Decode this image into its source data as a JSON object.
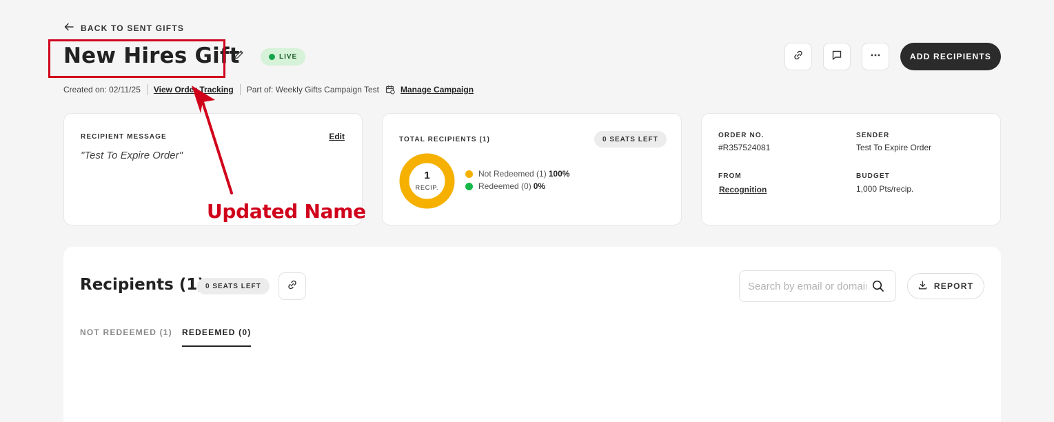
{
  "nav": {
    "back_label": "BACK TO SENT GIFTS"
  },
  "header": {
    "title": "New Hires Gift",
    "status": "LIVE",
    "add_recipients_label": "ADD RECIPIENTS"
  },
  "meta": {
    "created": "Created on: 02/11/25",
    "view_order_tracking": "View Order Tracking",
    "part_of": "Part of: Weekly Gifts Campaign Test",
    "manage_campaign": "Manage Campaign"
  },
  "annotation": {
    "text": "Updated Name",
    "color": "#d0021b"
  },
  "message_card": {
    "label": "RECIPIENT MESSAGE",
    "edit_label": "Edit",
    "message": "\"Test To Expire Order\""
  },
  "recipients_card": {
    "label": "TOTAL RECIPIENTS (1)",
    "seats_left": "0 SEATS LEFT",
    "donut_count": "1",
    "donut_unit": "RECIP.",
    "legend": [
      {
        "label": "Not Redeemed (1)",
        "value": "100%",
        "color": "#f5b000"
      },
      {
        "label": "Redeemed (0)",
        "value": "0%",
        "color": "#17b84a"
      }
    ]
  },
  "order_card": {
    "order_no_label": "ORDER NO.",
    "order_no": "#R357524081",
    "sender_label": "SENDER",
    "sender": "Test To Expire Order",
    "from_label": "FROM",
    "from": "Recognition",
    "budget_label": "BUDGET",
    "budget": "1,000 Pts/recip."
  },
  "recipients_section": {
    "title": "Recipients (1)",
    "seats_left": "0 SEATS LEFT",
    "search_placeholder": "Search by email or domain",
    "report_label": "REPORT",
    "tabs": [
      {
        "label": "NOT REDEEMED (1)",
        "active": false
      },
      {
        "label": "REDEEMED (0)",
        "active": true
      }
    ]
  }
}
